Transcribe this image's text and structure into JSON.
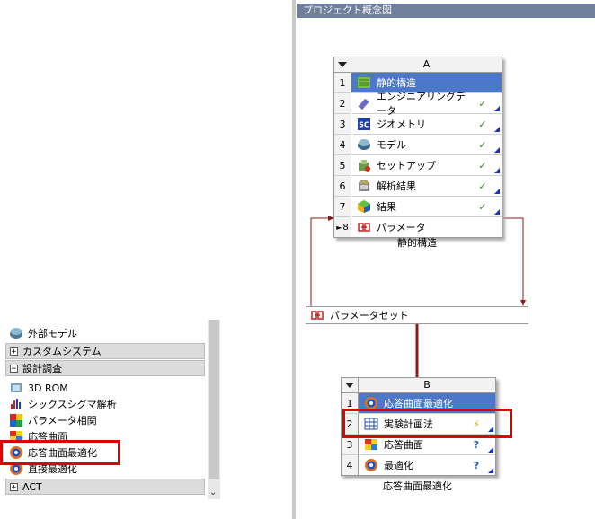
{
  "toolbox": {
    "items_top": [
      {
        "label": "外部モデル",
        "icon": "external-model-icon"
      }
    ],
    "groups": [
      {
        "label": "カスタムシステム",
        "expanded": false,
        "sign": "+"
      },
      {
        "label": "設計調査",
        "expanded": true,
        "sign": "−"
      }
    ],
    "design_items": [
      {
        "label": "3D ROM",
        "icon": "rom-icon"
      },
      {
        "label": "シックスシグマ解析",
        "icon": "six-sigma-icon"
      },
      {
        "label": "パラメータ相関",
        "icon": "correlation-icon"
      },
      {
        "label": "応答曲面",
        "icon": "response-surface-icon"
      },
      {
        "label": "応答曲面最適化",
        "icon": "response-surface-optimization-icon"
      },
      {
        "label": "直接最適化",
        "icon": "direct-optimization-icon"
      }
    ],
    "act": {
      "label": "ACT",
      "sign": "+"
    }
  },
  "schematic": {
    "title": "プロジェクト概念図",
    "system_a": {
      "letter": "A",
      "caption": "静的構造",
      "cells": [
        {
          "n": "1",
          "label": "静的構造",
          "icon": "static-structural-icon",
          "status": ""
        },
        {
          "n": "2",
          "label": "エンジニアリングデータ",
          "icon": "engineering-data-icon",
          "status": "✓"
        },
        {
          "n": "3",
          "label": "ジオメトリ",
          "icon": "geometry-icon",
          "status": "✓"
        },
        {
          "n": "4",
          "label": "モデル",
          "icon": "model-icon",
          "status": "✓"
        },
        {
          "n": "5",
          "label": "セットアップ",
          "icon": "setup-icon",
          "status": "✓"
        },
        {
          "n": "6",
          "label": "解析結果",
          "icon": "solution-icon",
          "status": "✓"
        },
        {
          "n": "7",
          "label": "結果",
          "icon": "results-icon",
          "status": "✓"
        },
        {
          "n": "8",
          "label": "パラメータ",
          "icon": "parameter-icon",
          "status": ""
        }
      ]
    },
    "param_set": {
      "label": "パラメータセット"
    },
    "system_b": {
      "letter": "B",
      "caption": "応答曲面最適化",
      "cells": [
        {
          "n": "1",
          "label": "応答曲面最適化",
          "icon": "response-surface-optimization-icon",
          "status": ""
        },
        {
          "n": "2",
          "label": "実験計画法",
          "icon": "design-of-experiments-icon",
          "status": "⚡"
        },
        {
          "n": "3",
          "label": "応答曲面",
          "icon": "response-surface-icon",
          "status": "?"
        },
        {
          "n": "4",
          "label": "最適化",
          "icon": "optimization-icon",
          "status": "?"
        }
      ]
    }
  },
  "colors": {
    "highlight": "#e00000",
    "selected": "#4b78c8",
    "title_bar": "#6f7f9c",
    "link": "#8b1a1a"
  }
}
